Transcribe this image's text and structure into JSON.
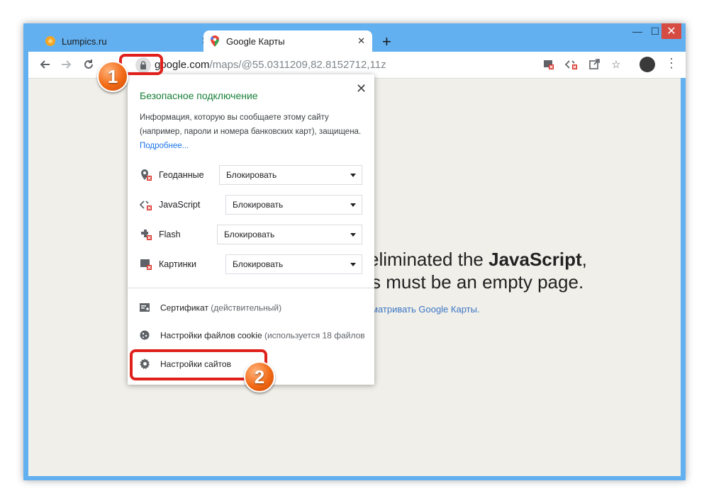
{
  "window": {
    "tabs": [
      {
        "title": "Lumpics.ru",
        "icon": "lumpics-favicon"
      },
      {
        "title": "Google Карты",
        "icon": "google-maps-favicon"
      }
    ],
    "close_glyph": "✕",
    "new_tab_glyph": "+"
  },
  "toolbar": {
    "url_host": "google.com",
    "url_path": "/maps/@55.0311209,82.8152712,11z"
  },
  "page": {
    "line1_pre": "eliminated the ",
    "line1_bold": "JavaScript",
    "line1_post": ",",
    "line2": "s must be an empty page.",
    "link": "матривать Google Карты."
  },
  "popup": {
    "title": "Безопасное подключение",
    "desc": "Информация, которую вы сообщаете этому сайту (например, пароли и номера банковских карт), защищена.",
    "more_link": "Подробнее...",
    "permissions": [
      {
        "label": "Геоданные",
        "value": "Блокировать",
        "icon": "location-blocked-icon"
      },
      {
        "label": "JavaScript",
        "value": "Блокировать",
        "icon": "javascript-blocked-icon"
      },
      {
        "label": "Flash",
        "value": "Блокировать",
        "icon": "flash-blocked-icon"
      },
      {
        "label": "Картинки",
        "value": "Блокировать",
        "icon": "images-blocked-icon"
      }
    ],
    "certificate": {
      "label": "Сертификат",
      "status": "(действительный)"
    },
    "cookies": {
      "label": "Настройки файлов cookie",
      "status": "(используется 18 файлов"
    },
    "site_settings": "Настройки сайтов"
  },
  "annotations": {
    "badge1": "1",
    "badge2": "2"
  },
  "colors": {
    "highlight": "#e0201b",
    "secure_title": "#188038",
    "badge": "#f26a16"
  }
}
